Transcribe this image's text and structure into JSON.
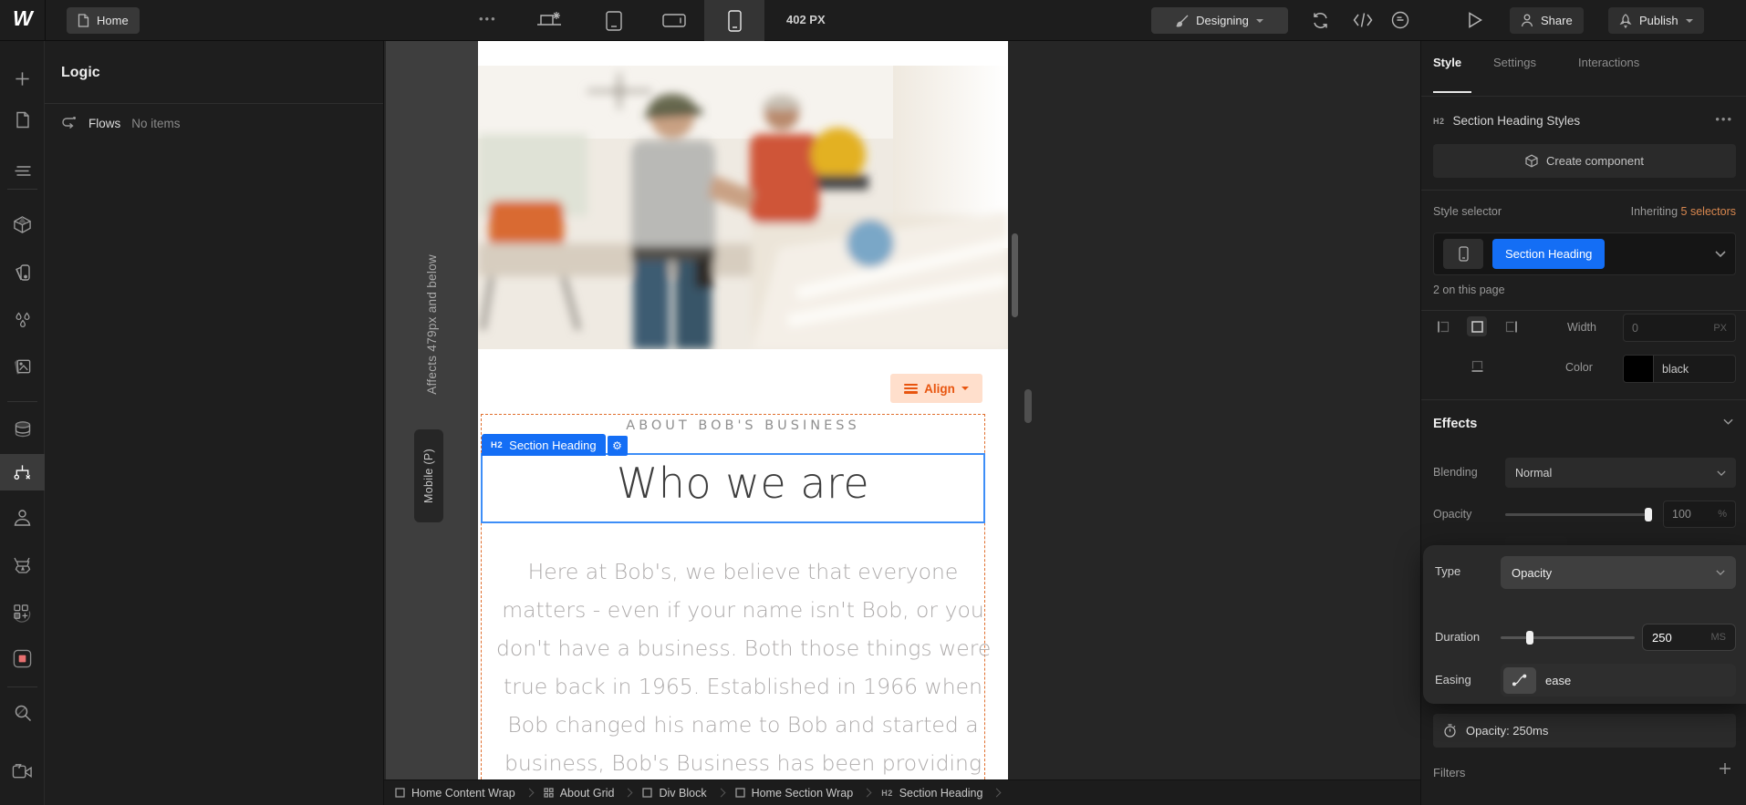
{
  "topbar": {
    "home": "Home",
    "canvas_width": "402 PX",
    "mode": "Designing",
    "share": "Share",
    "publish": "Publish"
  },
  "logic_panel": {
    "title": "Logic",
    "flows": "Flows",
    "flows_empty": "No items"
  },
  "canvas": {
    "affects": "Affects 479px and below",
    "breakpoint": "Mobile (P)",
    "align": "Align",
    "eyebrow": "ABOUT BOB'S BUSINESS",
    "badge_tag": "H2",
    "badge_label": "Section Heading",
    "heading": "Who we are",
    "paragraph_lines": [
      "Here at Bob's, we believe that everyone",
      "matters - even if your name isn't Bob, or you",
      "don't have a business. Both those things were",
      "true back in 1965. Established in 1966 when",
      "Bob changed his name to Bob and started a",
      "business, Bob's Business has been providing"
    ]
  },
  "panel": {
    "tabs": [
      "Style",
      "Settings",
      "Interactions"
    ],
    "title_tag": "H2",
    "title": "Section Heading Styles",
    "create_component": "Create component",
    "style_selector": "Style selector",
    "inheriting": "Inheriting",
    "inheriting_count": "5 selectors",
    "selector": "Section Heading",
    "usage": "2 on this page",
    "width_label": "Width",
    "width_value": "0",
    "width_unit": "PX",
    "color_label": "Color",
    "color_value": "black",
    "effects_title": "Effects",
    "blending_label": "Blending",
    "blending_value": "Normal",
    "opacity_label": "Opacity",
    "opacity_value": "100",
    "opacity_unit": "%",
    "type_label": "Type",
    "type_value": "Opacity",
    "duration_label": "Duration",
    "duration_value": "250",
    "duration_unit": "MS",
    "easing_label": "Easing",
    "easing_value": "ease",
    "transition_item": "Opacity: 250ms",
    "filters_label": "Filters"
  },
  "breadcrumb": {
    "items": [
      {
        "label": "Home Content Wrap"
      },
      {
        "label": "About Grid"
      },
      {
        "label": "Div Block"
      },
      {
        "label": "Home Section Wrap"
      },
      {
        "tag": "H2",
        "label": "Section Heading"
      }
    ]
  },
  "colors": {
    "accent_blue": "#146EF5",
    "accent_orange": "#E8550F",
    "inherit_orange": "#D8874F",
    "record_red": "#E87070",
    "swatch_black": "#000000"
  }
}
